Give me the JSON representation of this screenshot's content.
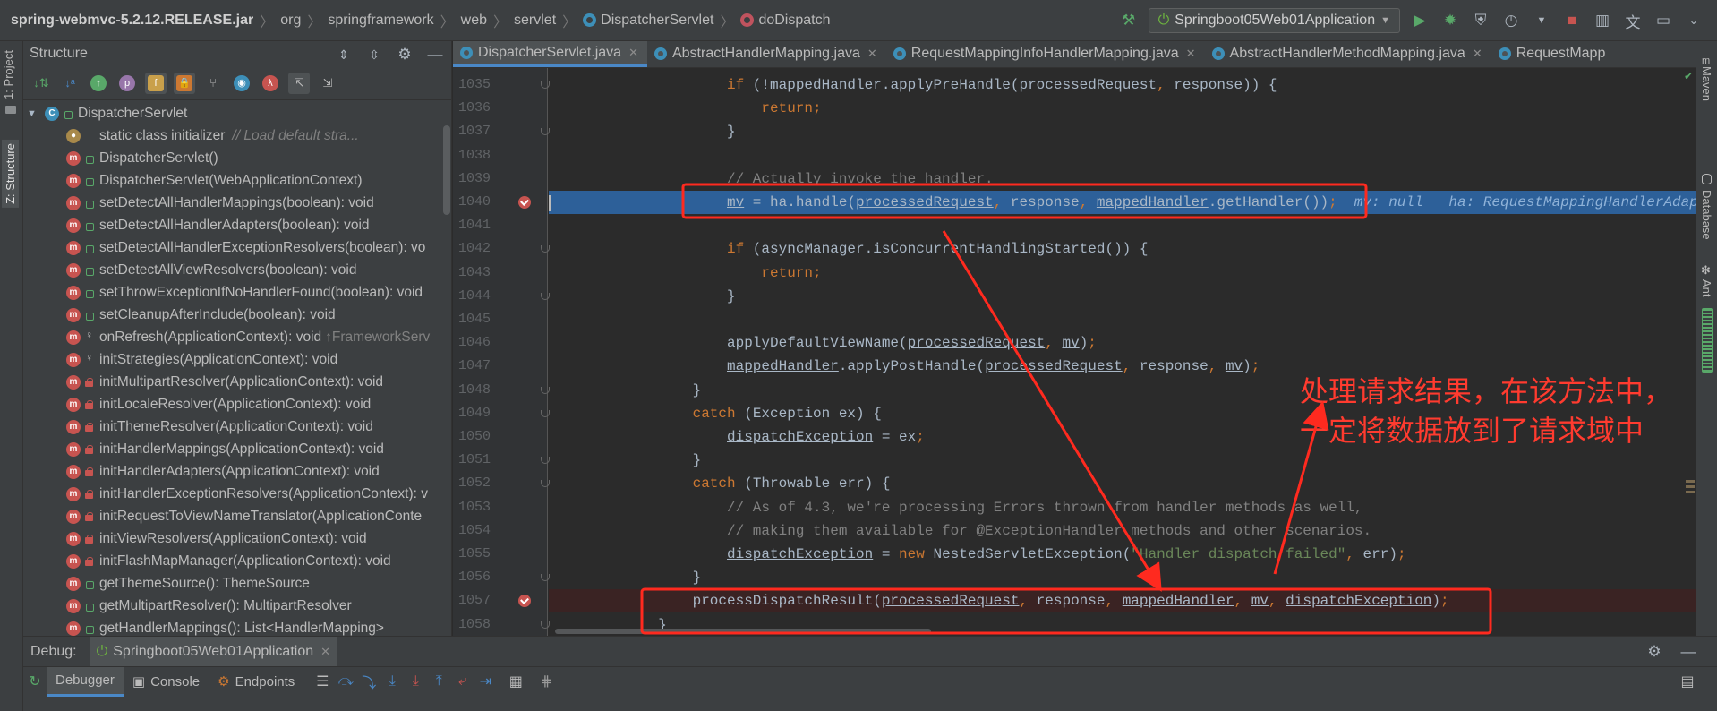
{
  "navbar": {
    "breadcrumbs": [
      {
        "label": "spring-webmvc-5.2.12.RELEASE.jar",
        "icon": ""
      },
      {
        "label": "org",
        "icon": ""
      },
      {
        "label": "springframework",
        "icon": ""
      },
      {
        "label": "web",
        "icon": ""
      },
      {
        "label": "servlet",
        "icon": ""
      },
      {
        "label": "DispatcherServlet",
        "icon": "class-icon"
      },
      {
        "label": "doDispatch",
        "icon": "method-icon"
      }
    ],
    "run_config": "Springboot05Web01Application"
  },
  "left_stripe": {
    "project": "1: Project",
    "structure": "Z: Structure"
  },
  "right_stripe": {
    "maven": "Maven",
    "database": "Database",
    "ant": "Ant"
  },
  "structure": {
    "title": "Structure",
    "root": "DispatcherServlet",
    "items": [
      {
        "icon": "s",
        "vis": "none",
        "name": "static class initializer",
        "hint": "// Load default stra..."
      },
      {
        "icon": "m",
        "vis": "pub",
        "name": "DispatcherServlet()",
        "hint": ""
      },
      {
        "icon": "m",
        "vis": "pub",
        "name": "DispatcherServlet(WebApplicationContext)",
        "hint": ""
      },
      {
        "icon": "m",
        "vis": "pub",
        "name": "setDetectAllHandlerMappings(boolean): void",
        "hint": ""
      },
      {
        "icon": "m",
        "vis": "pub",
        "name": "setDetectAllHandlerAdapters(boolean): void",
        "hint": ""
      },
      {
        "icon": "m",
        "vis": "pub",
        "name": "setDetectAllHandlerExceptionResolvers(boolean): vo",
        "hint": ""
      },
      {
        "icon": "m",
        "vis": "pub",
        "name": "setDetectAllViewResolvers(boolean): void",
        "hint": ""
      },
      {
        "icon": "m",
        "vis": "pub",
        "name": "setThrowExceptionIfNoHandlerFound(boolean): void",
        "hint": ""
      },
      {
        "icon": "m",
        "vis": "pub",
        "name": "setCleanupAfterInclude(boolean): void",
        "hint": ""
      },
      {
        "icon": "m",
        "vis": "pro",
        "name": "onRefresh(ApplicationContext): void",
        "hint": "↑FrameworkServ"
      },
      {
        "icon": "m",
        "vis": "pro",
        "name": "initStrategies(ApplicationContext): void",
        "hint": ""
      },
      {
        "icon": "m",
        "vis": "pri",
        "name": "initMultipartResolver(ApplicationContext): void",
        "hint": ""
      },
      {
        "icon": "m",
        "vis": "pri",
        "name": "initLocaleResolver(ApplicationContext): void",
        "hint": ""
      },
      {
        "icon": "m",
        "vis": "pri",
        "name": "initThemeResolver(ApplicationContext): void",
        "hint": ""
      },
      {
        "icon": "m",
        "vis": "pri",
        "name": "initHandlerMappings(ApplicationContext): void",
        "hint": ""
      },
      {
        "icon": "m",
        "vis": "pri",
        "name": "initHandlerAdapters(ApplicationContext): void",
        "hint": ""
      },
      {
        "icon": "m",
        "vis": "pri",
        "name": "initHandlerExceptionResolvers(ApplicationContext): v",
        "hint": ""
      },
      {
        "icon": "m",
        "vis": "pri",
        "name": "initRequestToViewNameTranslator(ApplicationConte",
        "hint": ""
      },
      {
        "icon": "m",
        "vis": "pri",
        "name": "initViewResolvers(ApplicationContext): void",
        "hint": ""
      },
      {
        "icon": "m",
        "vis": "pri",
        "name": "initFlashMapManager(ApplicationContext): void",
        "hint": ""
      },
      {
        "icon": "m",
        "vis": "pub",
        "name": "getThemeSource(): ThemeSource",
        "hint": ""
      },
      {
        "icon": "m",
        "vis": "pub",
        "name": "getMultipartResolver(): MultipartResolver",
        "hint": ""
      },
      {
        "icon": "m",
        "vis": "pub",
        "name": "getHandlerMappings(): List<HandlerMapping>",
        "hint": ""
      }
    ]
  },
  "editor": {
    "tabs": [
      {
        "label": "DispatcherServlet.java",
        "active": true
      },
      {
        "label": "AbstractHandlerMapping.java",
        "active": false
      },
      {
        "label": "RequestMappingInfoHandlerMapping.java",
        "active": false
      },
      {
        "label": "AbstractHandlerMethodMapping.java",
        "active": false
      },
      {
        "label": "RequestMapp",
        "active": false
      }
    ],
    "lines": [
      {
        "n": "1035",
        "indent": 5,
        "text": "if (!mappedHandler.applyPreHandle(processedRequest, response)) {"
      },
      {
        "n": "1036",
        "indent": 6,
        "text": "return;"
      },
      {
        "n": "1037",
        "indent": 5,
        "text": "}"
      },
      {
        "n": "1038",
        "indent": 0,
        "text": ""
      },
      {
        "n": "1039",
        "indent": 5,
        "text": "// Actually invoke the handler."
      },
      {
        "n": "1040",
        "indent": 5,
        "text": "mv = ha.handle(processedRequest, response, mappedHandler.getHandler());"
      },
      {
        "n": "1041",
        "indent": 0,
        "text": ""
      },
      {
        "n": "1042",
        "indent": 5,
        "text": "if (asyncManager.isConcurrentHandlingStarted()) {"
      },
      {
        "n": "1043",
        "indent": 6,
        "text": "return;"
      },
      {
        "n": "1044",
        "indent": 5,
        "text": "}"
      },
      {
        "n": "1045",
        "indent": 0,
        "text": ""
      },
      {
        "n": "1046",
        "indent": 5,
        "text": "applyDefaultViewName(processedRequest, mv);"
      },
      {
        "n": "1047",
        "indent": 5,
        "text": "mappedHandler.applyPostHandle(processedRequest, response, mv);"
      },
      {
        "n": "1048",
        "indent": 4,
        "text": "}"
      },
      {
        "n": "1049",
        "indent": 4,
        "text": "catch (Exception ex) {"
      },
      {
        "n": "1050",
        "indent": 5,
        "text": "dispatchException = ex;"
      },
      {
        "n": "1051",
        "indent": 4,
        "text": "}"
      },
      {
        "n": "1052",
        "indent": 4,
        "text": "catch (Throwable err) {"
      },
      {
        "n": "1053",
        "indent": 5,
        "text": "// As of 4.3, we're processing Errors thrown from handler methods as well,"
      },
      {
        "n": "1054",
        "indent": 5,
        "text": "// making them available for @ExceptionHandler methods and other scenarios."
      },
      {
        "n": "1055",
        "indent": 5,
        "text": "dispatchException = new NestedServletException(\"Handler dispatch failed\", err);"
      },
      {
        "n": "1056",
        "indent": 4,
        "text": "}"
      },
      {
        "n": "1057",
        "indent": 4,
        "text": "processDispatchResult(processedRequest, response, mappedHandler, mv, dispatchException);"
      },
      {
        "n": "1058",
        "indent": 3,
        "text": "}"
      }
    ],
    "inline_debug": "mv: null   ha: RequestMappingHandlerAdap",
    "annotation": [
      "处理请求结果，在该方法中，",
      "一定将数据放到了请求域中"
    ]
  },
  "debug": {
    "title": "Debug:",
    "session": "Springboot05Web01Application",
    "tabs": [
      {
        "label": "Debugger",
        "active": true
      },
      {
        "label": "Console",
        "active": false
      },
      {
        "label": "Endpoints",
        "active": false
      }
    ]
  },
  "colors": {
    "background": "#2b2b2b",
    "panel": "#3c3f41",
    "execution_line": "#2d6099",
    "keyword": "#cc7832",
    "comment": "#808080",
    "string": "#6a8759",
    "annotation_red": "#ff2a1f"
  }
}
